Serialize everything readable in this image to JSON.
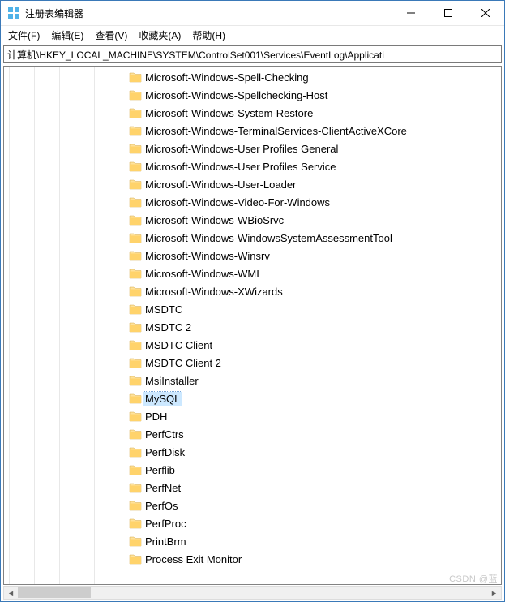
{
  "title": "注册表编辑器",
  "menu": {
    "file": "文件(F)",
    "edit": "编辑(E)",
    "view": "查看(V)",
    "favorites": "收藏夹(A)",
    "help": "帮助(H)"
  },
  "address": "计算机\\HKEY_LOCAL_MACHINE\\SYSTEM\\ControlSet001\\Services\\EventLog\\Applicati",
  "tree": [
    {
      "label": "Microsoft-Windows-Spell-Checking",
      "selected": false
    },
    {
      "label": "Microsoft-Windows-Spellchecking-Host",
      "selected": false
    },
    {
      "label": "Microsoft-Windows-System-Restore",
      "selected": false
    },
    {
      "label": "Microsoft-Windows-TerminalServices-ClientActiveXCore",
      "selected": false
    },
    {
      "label": "Microsoft-Windows-User Profiles General",
      "selected": false
    },
    {
      "label": "Microsoft-Windows-User Profiles Service",
      "selected": false
    },
    {
      "label": "Microsoft-Windows-User-Loader",
      "selected": false
    },
    {
      "label": "Microsoft-Windows-Video-For-Windows",
      "selected": false
    },
    {
      "label": "Microsoft-Windows-WBioSrvc",
      "selected": false
    },
    {
      "label": "Microsoft-Windows-WindowsSystemAssessmentTool",
      "selected": false
    },
    {
      "label": "Microsoft-Windows-Winsrv",
      "selected": false
    },
    {
      "label": "Microsoft-Windows-WMI",
      "selected": false
    },
    {
      "label": "Microsoft-Windows-XWizards",
      "selected": false
    },
    {
      "label": "MSDTC",
      "selected": false
    },
    {
      "label": "MSDTC 2",
      "selected": false
    },
    {
      "label": "MSDTC Client",
      "selected": false
    },
    {
      "label": "MSDTC Client 2",
      "selected": false
    },
    {
      "label": "MsiInstaller",
      "selected": false
    },
    {
      "label": "MySQL",
      "selected": true
    },
    {
      "label": "PDH",
      "selected": false
    },
    {
      "label": "PerfCtrs",
      "selected": false
    },
    {
      "label": "PerfDisk",
      "selected": false
    },
    {
      "label": "Perflib",
      "selected": false
    },
    {
      "label": "PerfNet",
      "selected": false
    },
    {
      "label": "PerfOs",
      "selected": false
    },
    {
      "label": "PerfProc",
      "selected": false
    },
    {
      "label": "PrintBrm",
      "selected": false
    },
    {
      "label": "Process Exit Monitor",
      "selected": false
    }
  ],
  "watermark": "CSDN @蓝"
}
